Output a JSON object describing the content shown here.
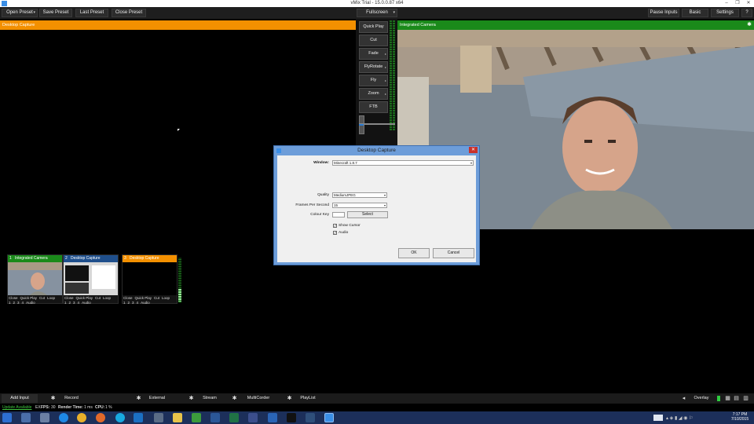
{
  "window": {
    "title": "vMix Trial - 15.0.0.87 x64"
  },
  "toolbar": {
    "open_preset": "Open Preset",
    "save_preset": "Save Preset",
    "last_preset": "Last Preset",
    "close_preset": "Close Preset",
    "fullscreen": "Fullscreen",
    "pause_inputs": "Pause Inputs",
    "basic": "Basic",
    "settings": "Settings",
    "help": "?"
  },
  "preview": {
    "title": "Desktop Capture"
  },
  "output": {
    "title": "Integrated Camera"
  },
  "transitions": {
    "quick_play": "Quick Play",
    "cut": "Cut",
    "fade": "Fade",
    "fly_rotate": "FlyRotate",
    "fly": "Fly",
    "zoom": "Zoom",
    "ftb": "FTB"
  },
  "inputs": [
    {
      "number": "1",
      "name": "Integrated Camera",
      "header_color": "#1a8a1a",
      "controls": [
        "Close",
        "Quick Play",
        "Cut",
        "Loop"
      ],
      "nums": [
        "1",
        "2",
        "3",
        "4"
      ],
      "audio": "Audio"
    },
    {
      "number": "2",
      "name": "Desktop Capture",
      "header_color": "#1f4f8c",
      "controls": [
        "Close",
        "Quick Play",
        "Cut",
        "Loop"
      ],
      "nums": [
        "1",
        "2",
        "3",
        "4"
      ],
      "audio": "Audio"
    },
    {
      "number": "3",
      "name": "Desktop Capture",
      "header_color": "#f39000",
      "controls": [
        "Close",
        "Quick Play",
        "Cut",
        "Loop"
      ],
      "nums": [
        "1",
        "2",
        "3",
        "4"
      ],
      "audio": "Audio"
    }
  ],
  "dialog": {
    "title": "Desktop Capture",
    "window_label": "Window:",
    "window_value": "Minecraft 1.8.7",
    "quality_label": "Quality",
    "quality_value": "MediumJPEG",
    "fps_label": "Frames Per Second",
    "fps_value": "15",
    "colour_key_label": "Colour Key",
    "select_button": "Select",
    "show_cursor_label": "Show Cursor",
    "show_cursor_checked": true,
    "audio_label": "Audio",
    "audio_checked": true,
    "ok": "OK",
    "cancel": "Cancel"
  },
  "bottombar": {
    "add_input": "Add Input",
    "record": "Record",
    "external": "External",
    "stream": "Stream",
    "multicorder": "MultiCorder",
    "playlist": "PlayList",
    "overlay": "Overlay"
  },
  "status": {
    "update": "Update Available",
    "ex": "EX",
    "fps_label": "FPS:",
    "fps_value": "30",
    "render_label": "Render Time:",
    "render_value": "1 ms",
    "cpu_label": "CPU:",
    "cpu_value": "1 %"
  },
  "taskbar": {
    "time": "7:17 PM",
    "date": "7/10/2015"
  },
  "colors": {
    "preview_accent": "#f39000",
    "output_accent": "#1a8a1a",
    "input2_accent": "#1f4f8c"
  }
}
